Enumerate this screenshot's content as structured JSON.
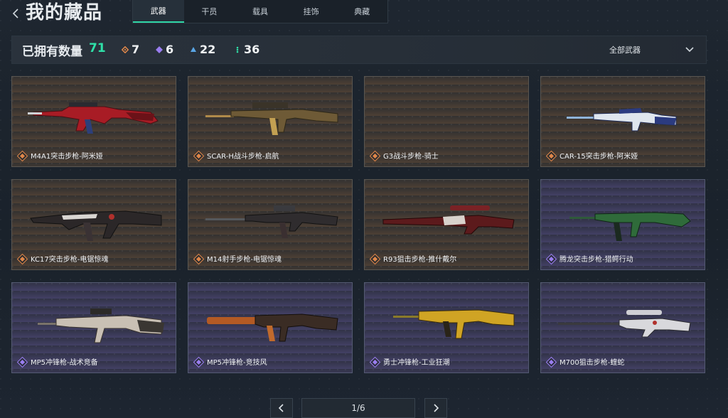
{
  "header": {
    "title": "我的藏品"
  },
  "tabs": [
    {
      "label": "武器",
      "active": true
    },
    {
      "label": "干员",
      "active": false
    },
    {
      "label": "载具",
      "active": false
    },
    {
      "label": "挂饰",
      "active": false
    },
    {
      "label": "典藏",
      "active": false
    }
  ],
  "stats": {
    "owned_label": "已拥有数量",
    "owned_count": "71",
    "counts": [
      {
        "icon": "orange-diamond-icon",
        "value": "7",
        "color": "#e0874a"
      },
      {
        "icon": "purple-diamond-icon",
        "value": "6",
        "color": "#9a7ef0"
      },
      {
        "icon": "blue-triangle-icon",
        "value": "22",
        "color": "#5aa6e6"
      },
      {
        "icon": "green-dots-icon",
        "value": "36",
        "color": "#2fe0a8"
      }
    ],
    "filter_label": "全部武器"
  },
  "items": [
    {
      "name": "M4A1突击步枪-阿米娅",
      "rarity": "orange"
    },
    {
      "name": "SCAR-H战斗步枪-启航",
      "rarity": "orange"
    },
    {
      "name": "G3战斗步枪-骑士",
      "rarity": "orange"
    },
    {
      "name": "CAR-15突击步枪-阿米娅",
      "rarity": "orange"
    },
    {
      "name": "KC17突击步枪-电锯惊魂",
      "rarity": "orange"
    },
    {
      "name": "M14射手步枪-电锯惊魂",
      "rarity": "orange"
    },
    {
      "name": "R93狙击步枪-推什戴尔",
      "rarity": "orange"
    },
    {
      "name": "腾龙突击步枪-猎鳄行动",
      "rarity": "purple"
    },
    {
      "name": "MP5冲锋枪-战术竞备",
      "rarity": "purple"
    },
    {
      "name": "MP5冲锋枪-竞技风",
      "rarity": "purple"
    },
    {
      "name": "勇士冲锋枪-工业狂潮",
      "rarity": "purple"
    },
    {
      "name": "M700狙击步枪-蝰蛇",
      "rarity": "purple"
    }
  ],
  "pagination": {
    "current": "1/6"
  },
  "colors": {
    "accent": "#2fd6a6",
    "orange": "#e0874a",
    "purple": "#9a7ef0"
  }
}
